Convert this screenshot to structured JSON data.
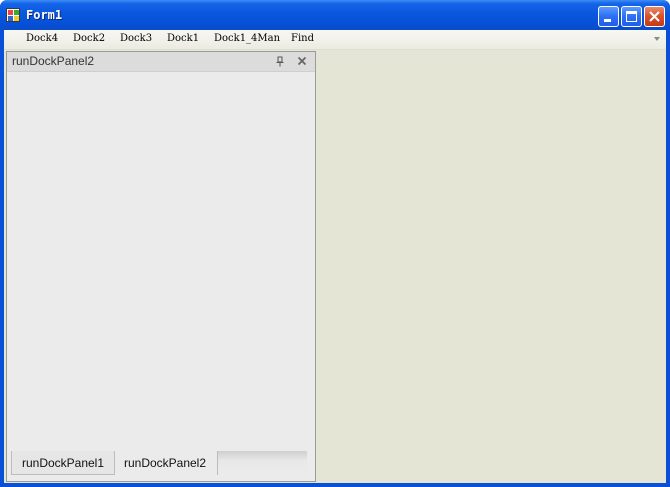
{
  "window": {
    "title": "Form1"
  },
  "menu": {
    "items": [
      "Dock4",
      "Dock2",
      "Dock3",
      "Dock1",
      "Dock1_4Man",
      "Find"
    ]
  },
  "dock_panel": {
    "title": "runDockPanel2",
    "tabs": [
      "runDockPanel1",
      "runDockPanel2"
    ],
    "active_tab": "runDockPanel2"
  },
  "colors": {
    "client_background": "#e5e5d6",
    "panel_background": "#ebebeb",
    "titlebar": "#0a57de"
  }
}
